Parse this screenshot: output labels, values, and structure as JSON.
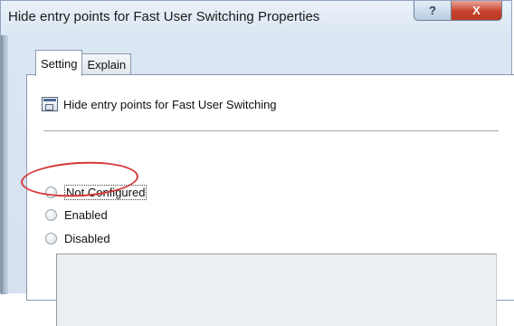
{
  "window": {
    "title": "Hide entry points for Fast User Switching Properties",
    "help_glyph": "?",
    "close_glyph": "X",
    "colors": {
      "close_button": "#c8422c",
      "highlight_circle": "#d43a3a"
    }
  },
  "tabs": [
    {
      "label": "Setting",
      "active": true
    },
    {
      "label": "Explain",
      "active": false
    }
  ],
  "policy": {
    "icon": "policy-setting-icon",
    "name": "Hide entry points for Fast User Switching"
  },
  "options": [
    {
      "label": "Not Configured",
      "selected": false,
      "focused": true
    },
    {
      "label": "Enabled",
      "selected": false,
      "highlighted": true
    },
    {
      "label": "Disabled",
      "selected": false
    }
  ]
}
